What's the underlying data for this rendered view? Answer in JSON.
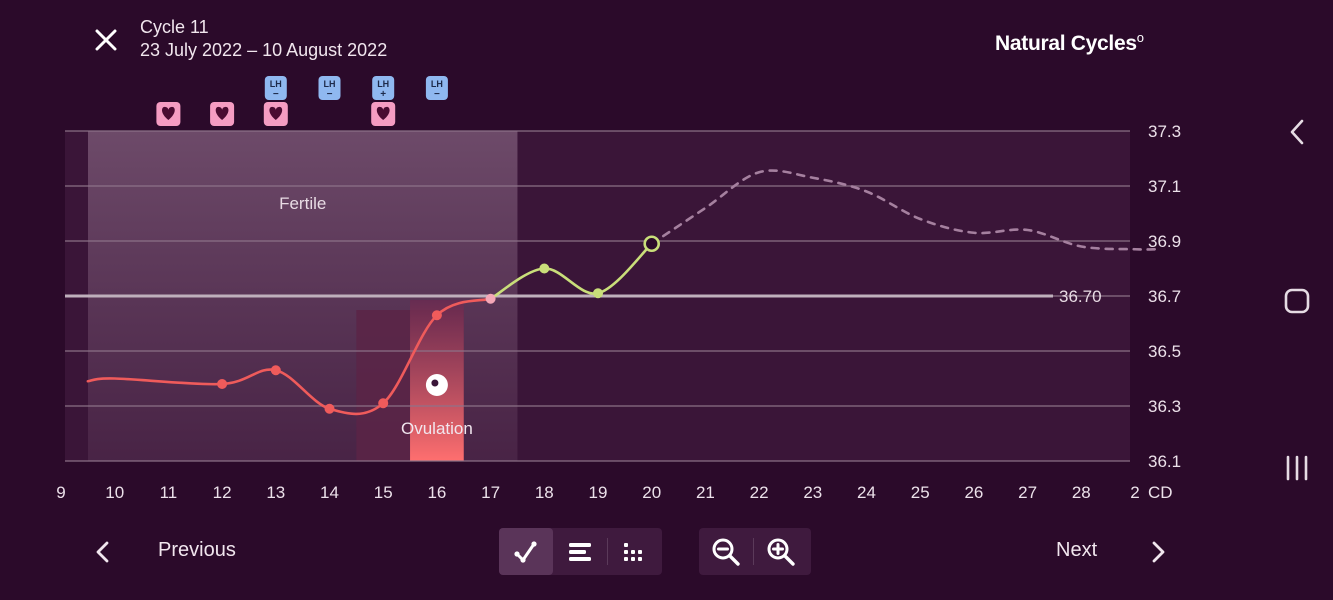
{
  "header": {
    "cycle_title": "Cycle 11",
    "cycle_dates": "23 July 2022 – 10 August 2022",
    "brand": "Natural Cycles",
    "brand_mark": "o",
    "close_icon": "close-icon"
  },
  "chart_data": {
    "type": "line",
    "title": "",
    "xlabel": "CD",
    "ylabel": "",
    "x_ticks": [
      "9",
      "10",
      "11",
      "12",
      "13",
      "14",
      "15",
      "16",
      "17",
      "18",
      "19",
      "20",
      "21",
      "22",
      "23",
      "24",
      "25",
      "26",
      "27",
      "28",
      "2"
    ],
    "y_ticks": [
      "37.3",
      "37.1",
      "36.9",
      "36.7",
      "36.5",
      "36.3",
      "36.1"
    ],
    "ylim": [
      36.1,
      37.3
    ],
    "xlim": [
      9.5,
      29.5
    ],
    "grid": true,
    "cover_line": {
      "value": 36.7,
      "label": "36.70"
    },
    "series": [
      {
        "phase": "pre-ovulation",
        "color": "#ef5b5b",
        "points": [
          [
            9.5,
            36.39
          ],
          [
            10,
            36.4
          ],
          [
            12,
            36.38
          ],
          [
            13,
            36.43
          ],
          [
            14,
            36.29
          ],
          [
            15,
            36.31
          ],
          [
            16,
            36.63
          ],
          [
            17,
            36.69
          ]
        ],
        "markers": [
          12,
          13,
          14,
          15,
          16
        ]
      },
      {
        "phase": "post-ovulation",
        "color": "#c9de7a",
        "points": [
          [
            17,
            36.69
          ],
          [
            18,
            36.8
          ],
          [
            19,
            36.71
          ],
          [
            20,
            36.89
          ]
        ],
        "markers": [
          18,
          19
        ],
        "open_marker": 20
      },
      {
        "phase": "prediction",
        "color": "#a5809f",
        "dashed": true,
        "points": [
          [
            20,
            36.89
          ],
          [
            21,
            37.02
          ],
          [
            22,
            37.15
          ],
          [
            23,
            37.13
          ],
          [
            24,
            37.08
          ],
          [
            25,
            36.98
          ],
          [
            26,
            36.93
          ],
          [
            27,
            36.94
          ],
          [
            28,
            36.88
          ],
          [
            29,
            36.87
          ],
          [
            29.4,
            36.87
          ]
        ]
      }
    ],
    "fertile_window": {
      "label": "Fertile",
      "start": 9.5,
      "end": 17.5
    },
    "ovulation": {
      "label": "Ovulation",
      "day": 16,
      "range_start": 14.5,
      "range_end": 16.5
    },
    "lh_tests": [
      {
        "day": 13,
        "result": "negative",
        "text": "LH",
        "sign": "−"
      },
      {
        "day": 14,
        "result": "negative",
        "text": "LH",
        "sign": "−"
      },
      {
        "day": 15,
        "result": "positive",
        "text": "LH",
        "sign": "+"
      },
      {
        "day": 16,
        "result": "negative",
        "text": "LH",
        "sign": "−"
      }
    ],
    "sex_days": [
      11,
      12,
      13,
      15
    ],
    "colors": {
      "background": "#2b0a2a",
      "plot_bg": "#3a1538",
      "fertile": "#5e3a5c",
      "ovulation": "#c2526b",
      "lh_badge": "#8fb8f0",
      "heart_badge": "#f59cc2"
    }
  },
  "toolbar": {
    "graph_icon": "graph-view-icon",
    "list_icon": "list-view-icon",
    "dots_icon": "calendar-dots-icon",
    "zoom_out_icon": "zoom-out-icon",
    "zoom_in_icon": "zoom-in-icon"
  },
  "footer": {
    "previous_label": "Previous",
    "next_label": "Next"
  },
  "system_nav": {
    "back_icon": "back-chevron-icon",
    "home_icon": "home-icon",
    "recents_icon": "recents-icon"
  }
}
